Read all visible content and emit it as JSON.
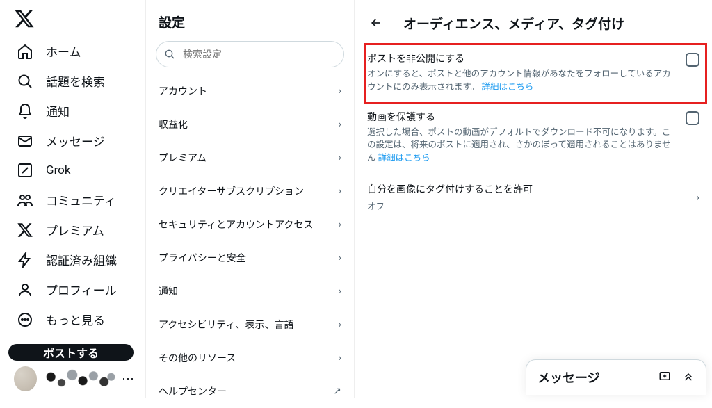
{
  "nav": {
    "items": [
      {
        "label": "ホーム",
        "icon": "home"
      },
      {
        "label": "話題を検索",
        "icon": "search"
      },
      {
        "label": "通知",
        "icon": "bell"
      },
      {
        "label": "メッセージ",
        "icon": "mail"
      },
      {
        "label": "Grok",
        "icon": "grok"
      },
      {
        "label": "コミュニティ",
        "icon": "community"
      },
      {
        "label": "プレミアム",
        "icon": "x"
      },
      {
        "label": "認証済み組織",
        "icon": "bolt"
      },
      {
        "label": "プロフィール",
        "icon": "person"
      },
      {
        "label": "もっと見る",
        "icon": "more"
      }
    ],
    "post_label": "ポストする"
  },
  "settings": {
    "title": "設定",
    "search_placeholder": "検索設定",
    "items": [
      {
        "label": "アカウント",
        "type": "chev"
      },
      {
        "label": "収益化",
        "type": "chev"
      },
      {
        "label": "プレミアム",
        "type": "chev"
      },
      {
        "label": "クリエイターサブスクリプション",
        "type": "chev"
      },
      {
        "label": "セキュリティとアカウントアクセス",
        "type": "chev"
      },
      {
        "label": "プライバシーと安全",
        "type": "chev"
      },
      {
        "label": "通知",
        "type": "chev"
      },
      {
        "label": "アクセシビリティ、表示、言語",
        "type": "chev"
      },
      {
        "label": "その他のリソース",
        "type": "chev"
      },
      {
        "label": "ヘルプセンター",
        "type": "ext"
      }
    ]
  },
  "detail": {
    "title": "オーディエンス、メディア、タグ付け",
    "protect_posts": {
      "label": "ポストを非公開にする",
      "desc": "オンにすると、ポストと他のアカウント情報があなたをフォローしているアカウントにのみ表示されます。",
      "link": "詳細はこちら"
    },
    "protect_video": {
      "label": "動画を保護する",
      "desc": "選択した場合、ポストの動画がデフォルトでダウンロード不可になります。この設定は、将来のポストに適用され、さかのぼって適用されることはありません",
      "link": "詳細はこちら"
    },
    "tagging": {
      "label": "自分を画像にタグ付けすることを許可",
      "status": "オフ"
    }
  },
  "messages": {
    "title": "メッセージ"
  }
}
